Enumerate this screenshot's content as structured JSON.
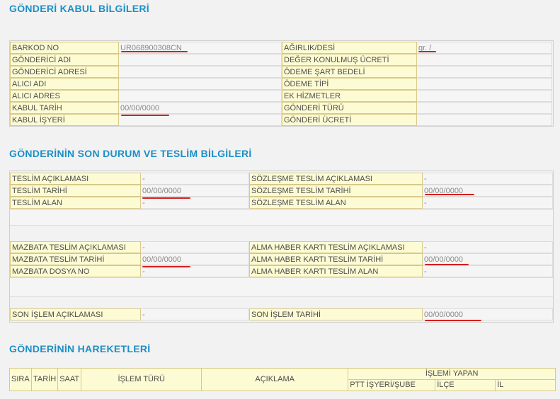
{
  "sections": {
    "kabul_title": "GÖNDERİ KABUL BİLGİLERİ",
    "teslim_title": "GÖNDERİNİN SON DURUM VE TESLİM BİLGİLERİ",
    "hareket_title": "GÖNDERİNİN HAREKETLERİ"
  },
  "kabul": {
    "left": [
      {
        "label": "BARKOD NO",
        "value": "UR068900308CN"
      },
      {
        "label": "GÖNDERİCİ ADI",
        "value": ""
      },
      {
        "label": "GÖNDERİCİ ADRESİ",
        "value": ""
      },
      {
        "label": "ALICI ADI",
        "value": ""
      },
      {
        "label": "ALICI ADRES",
        "value": ""
      },
      {
        "label": "KABUL TARİH",
        "value": "00/00/0000"
      },
      {
        "label": "KABUL İŞYERİ",
        "value": ""
      }
    ],
    "right": [
      {
        "label": "AĞIRLIK/DESİ",
        "value": "gr. /"
      },
      {
        "label": "DEĞER KONULMUŞ ÜCRETİ",
        "value": ""
      },
      {
        "label": "ÖDEME ŞART BEDELİ",
        "value": ""
      },
      {
        "label": "ÖDEME TİPİ",
        "value": ""
      },
      {
        "label": "EK HİZMETLER",
        "value": ""
      },
      {
        "label": "GÖNDERİ TÜRÜ",
        "value": ""
      },
      {
        "label": "GÖNDERİ ÜCRETİ",
        "value": ""
      }
    ]
  },
  "teslim": {
    "left1": [
      {
        "label": "TESLİM AÇIKLAMASI",
        "value": "-"
      },
      {
        "label": "TESLİM TARİHİ",
        "value": "00/00/0000"
      },
      {
        "label": "TESLİM ALAN",
        "value": "-"
      }
    ],
    "right1": [
      {
        "label": "SÖZLEŞME TESLİM AÇIKLAMASI",
        "value": "-"
      },
      {
        "label": "SÖZLEŞME TESLİM TARİHİ",
        "value": "00/00/0000"
      },
      {
        "label": "SÖZLEŞME TESLİM ALAN",
        "value": "-"
      }
    ],
    "left2": [
      {
        "label": "MAZBATA TESLİM AÇIKLAMASI",
        "value": "-"
      },
      {
        "label": "MAZBATA TESLİM TARİHİ",
        "value": "00/00/0000"
      },
      {
        "label": "MAZBATA DOSYA NO",
        "value": "-"
      }
    ],
    "right2": [
      {
        "label": "ALMA HABER KARTI TESLİM AÇIKLAMASI",
        "value": "-"
      },
      {
        "label": "ALMA HABER KARTI TESLİM TARİHİ",
        "value": "00/00/0000"
      },
      {
        "label": "ALMA HABER KARTI TESLİM ALAN",
        "value": "-"
      }
    ],
    "left3": [
      {
        "label": "SON İŞLEM AÇIKLAMASI",
        "value": "-"
      }
    ],
    "right3": [
      {
        "label": "SON İŞLEM TARİHİ",
        "value": "00/00/0000"
      }
    ]
  },
  "hareketler": {
    "sira": "SIRA",
    "tarih": "TARİH",
    "saat": "SAAT",
    "islem_turu": "İŞLEM TÜRÜ",
    "aciklama": "AÇIKLAMA",
    "islemi_yapan": "İŞLEMİ YAPAN",
    "ptt_isyeri": "PTT İŞYERİ/ŞUBE",
    "ilce": "İLÇE",
    "il": "İL"
  },
  "colors": {
    "heading": "#1b8fc6",
    "label_bg": "#fdfbd3",
    "annotation": "#d61f1f"
  }
}
